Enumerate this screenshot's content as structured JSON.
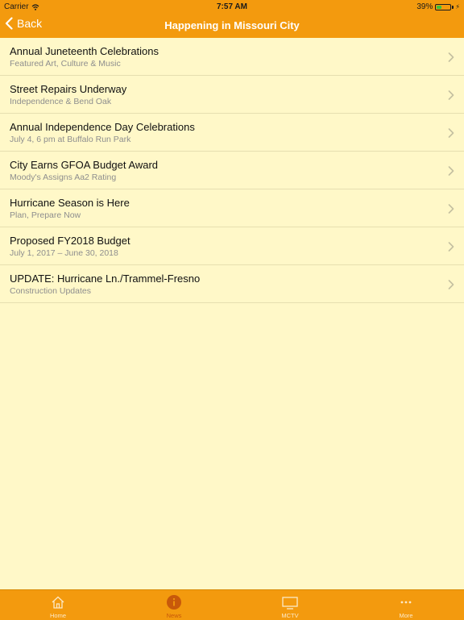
{
  "status_bar": {
    "carrier": "Carrier",
    "time": "7:57 AM",
    "battery_percent": "39%",
    "battery_level": 0.39,
    "battery_color": "#3CC13C"
  },
  "nav": {
    "back_label": "Back",
    "title": "Happening in Missouri City",
    "bar_color": "#F39A0E"
  },
  "news_items": [
    {
      "title": "Annual Juneteenth Celebrations",
      "subtitle": "Featured Art, Culture & Music"
    },
    {
      "title": "Street Repairs Underway",
      "subtitle": "Independence & Bend Oak"
    },
    {
      "title": "Annual Independence Day Celebrations",
      "subtitle": "July 4, 6 pm at Buffalo Run Park"
    },
    {
      "title": "City Earns GFOA Budget Award",
      "subtitle": "Moody's Assigns Aa2 Rating"
    },
    {
      "title": "Hurricane Season is Here",
      "subtitle": "Plan, Prepare Now"
    },
    {
      "title": "Proposed FY2018 Budget",
      "subtitle": "July 1, 2017 – June 30, 2018"
    },
    {
      "title": "UPDATE: Hurricane Ln./Trammel-Fresno",
      "subtitle": "Construction Updates"
    }
  ],
  "tabs": [
    {
      "label": "Home",
      "icon": "home-icon"
    },
    {
      "label": "News",
      "icon": "news-icon",
      "active": true
    },
    {
      "label": "MCTV",
      "icon": "tv-icon"
    },
    {
      "label": "More",
      "icon": "more-icon"
    }
  ],
  "colors": {
    "background": "#FFF8C8",
    "accent": "#F39A0E",
    "active_tab": "#C8590A"
  }
}
